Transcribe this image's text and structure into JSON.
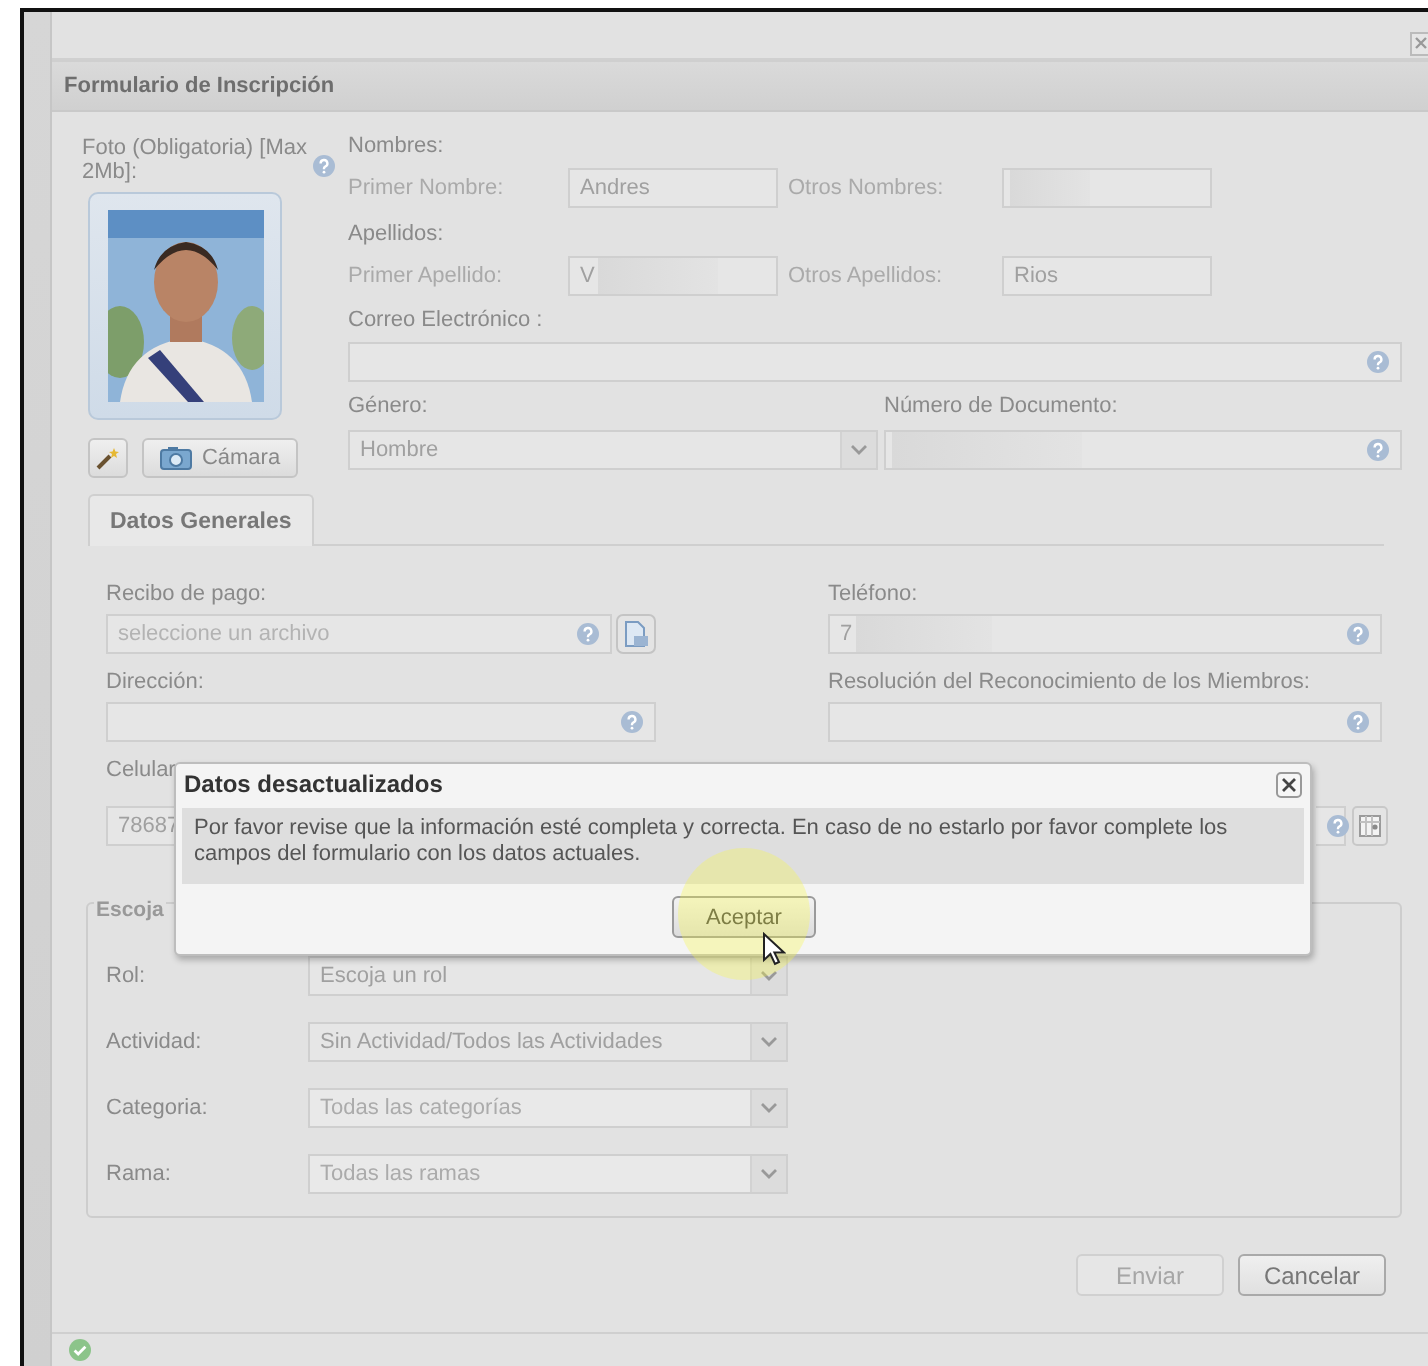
{
  "form": {
    "title": "Formulario de Inscripción"
  },
  "photo": {
    "label": "Foto (Obligatoria) [Max 2Mb]:",
    "camera_button": "Cámara"
  },
  "nombres": {
    "heading": "Nombres:",
    "fields": [
      {
        "label": "Primer Nombre:",
        "value": "Andres",
        "redacted": false
      },
      {
        "label": "Otros Nombres:",
        "redacted": true
      }
    ]
  },
  "apellidos": {
    "heading": "Apellidos:",
    "fields": [
      {
        "label": "Primer Apellido:",
        "value": "V",
        "redacted": true
      },
      {
        "label": "Otros Apellidos:",
        "value": "Rios",
        "redacted": false
      }
    ]
  },
  "email": {
    "label": "Correo Electrónico :"
  },
  "gender": {
    "label": "Género:",
    "value": "Hombre"
  },
  "document": {
    "label": "Número de Documento:",
    "redacted": true
  },
  "tabs": [
    {
      "label": "Datos Generales",
      "selected": true
    }
  ],
  "general": {
    "receipt": {
      "label": "Recibo de pago:",
      "placeholder": "seleccione un archivo"
    },
    "phone": {
      "label": "Teléfono:",
      "value": "7",
      "redacted": true
    },
    "address": {
      "label": "Dirección:"
    },
    "resolution": {
      "label": "Resolución del Reconocimiento de los Miembros:"
    },
    "mobile": {
      "label": "Celular",
      "value": "78687"
    }
  },
  "role_group": {
    "legend": "Escoja",
    "rows": [
      {
        "label": "Rol:",
        "value": "Escoja un rol",
        "disabled": false
      },
      {
        "label": "Actividad:",
        "value": "Sin Actividad/Todos las Actividades",
        "disabled": false
      },
      {
        "label": "Categoria:",
        "value": "Todas las categorías",
        "disabled": true
      },
      {
        "label": "Rama:",
        "value": "Todas las ramas",
        "disabled": true
      }
    ]
  },
  "buttons": [
    {
      "label": "Enviar",
      "disabled": true
    },
    {
      "label": "Cancelar",
      "disabled": false
    }
  ],
  "dialog": {
    "title": "Datos desactualizados",
    "message": "Por favor revise que la información esté completa y correcta. En caso de no estarlo por favor complete los campos del formulario con los datos actuales.",
    "button": "Aceptar"
  }
}
